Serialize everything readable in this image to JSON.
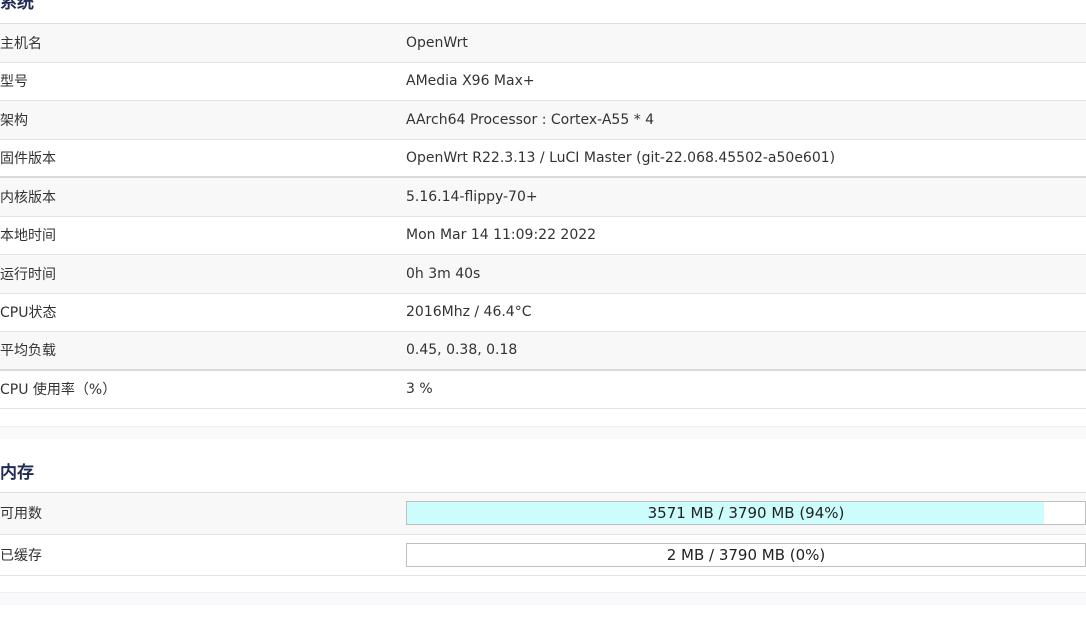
{
  "system": {
    "title": "系统",
    "rows": [
      {
        "label": "主机名",
        "value": "OpenWrt"
      },
      {
        "label": "型号",
        "value": "AMedia X96 Max+"
      },
      {
        "label": "架构",
        "value": "AArch64 Processor : Cortex-A55 * 4"
      },
      {
        "label": "固件版本",
        "value": "OpenWrt R22.3.13 / LuCI Master (git-22.068.45502-a50e601)"
      },
      {
        "label": "内核版本",
        "value": "5.16.14-flippy-70+"
      },
      {
        "label": "本地时间",
        "value": "Mon Mar 14 11:09:22 2022"
      },
      {
        "label": "运行时间",
        "value": "0h 3m 40s"
      },
      {
        "label": "CPU状态",
        "value": "2016Mhz / 46.4°C"
      },
      {
        "label": "平均负载",
        "value": "0.45, 0.38, 0.18"
      },
      {
        "label": "CPU 使用率（%）",
        "value": "3 %"
      }
    ]
  },
  "memory": {
    "title": "内存",
    "rows": [
      {
        "label": "可用数",
        "value": "3571 MB / 3790 MB (94%)",
        "percent": 94
      },
      {
        "label": "已缓存",
        "value": "2 MB / 3790 MB (0%)",
        "percent": 0
      }
    ]
  },
  "colors": {
    "accent_title": "#1f2b55",
    "bar_fill": "#ccfcfc",
    "bar_border": "#bfbfbf"
  }
}
